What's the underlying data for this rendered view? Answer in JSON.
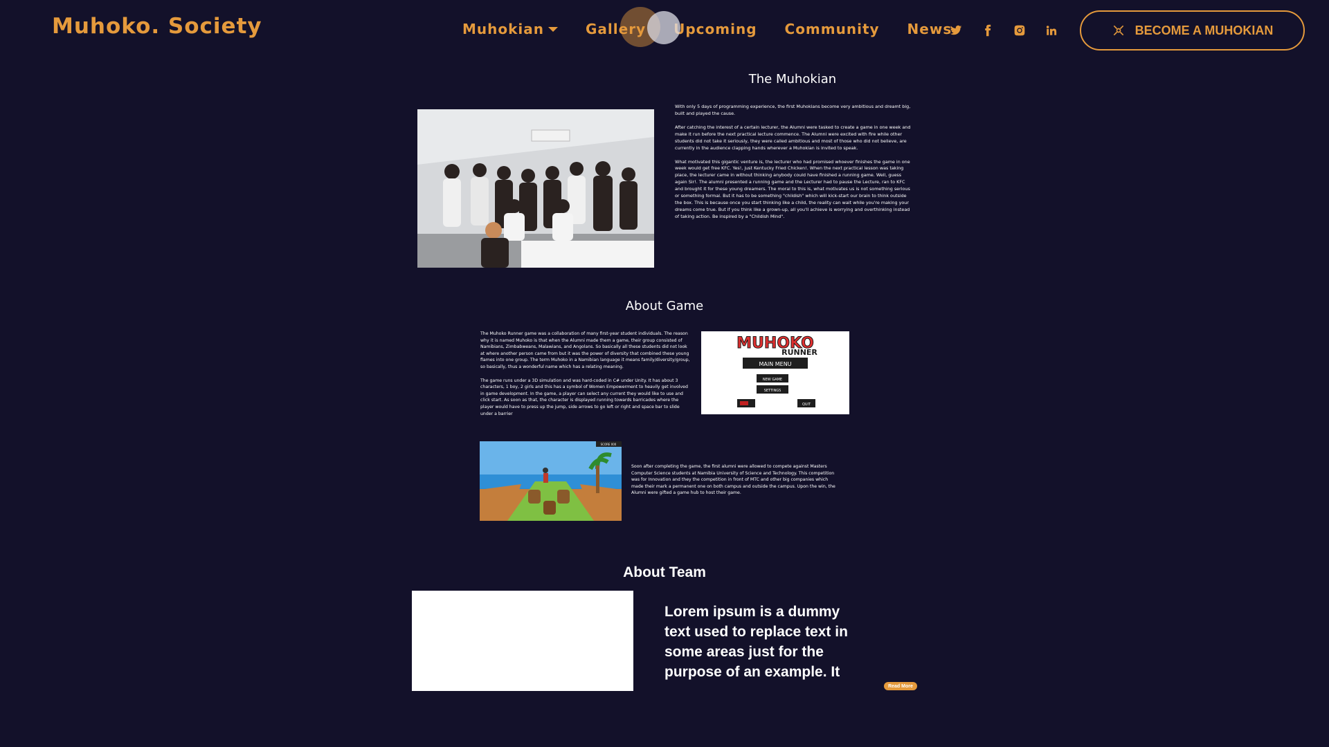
{
  "navbar": {
    "brand": "Muhoko. Society",
    "links": [
      {
        "label": "Muhokian",
        "dropdown": true
      },
      {
        "label": "Gallery"
      },
      {
        "label": "Upcoming"
      },
      {
        "label": "Community"
      },
      {
        "label": "News"
      }
    ],
    "socials": [
      "twitter-icon",
      "facebook-icon",
      "instagram-icon",
      "linkedin-icon"
    ],
    "cta_label": "BECOME A MUHOKIAN"
  },
  "muhokian": {
    "title": "The Muhokian",
    "paragraphs": [
      "With only 5 days of programming experience, the first Muhokians become very ambitious and dreamt big, built and played the cause.",
      "After catching the interest of a certain lecturer, the Alumni were tasked to create a game in one week and make it run before the next practical lecture commence. The Alumni were excited with fire while other students did not take it seriously, they were called ambitious and most of those who did not believe, are currently in the audience clapping hands wherever a Muhokian is invited to speak.",
      "What motivated this gigantic venture is, the lecturer who had promised whoever finishes the game in one week would get free KFC. Yes!, just Kentucky Fried Chicken!. When the next practical lesson was taking place, the lecturer came in without thinking anybody could have finished a running game. Well, guess again Sir!. The alumni presented a running game and the Lecturer had to pause the Lecture, ran to KFC and brought it for these young dreamers. The moral to this is, what motivates us is not something serious or something formal. But it has to be something \"childish\" which will kick-start our brain to think outside the box. This is because once you start thinking like a child, the reality can wait while you're making your dreams come true. But if you think like a grown-up, all you'll achieve is worrying and overthinking instead of taking action. Be inspired by a \"Childish Mind\"."
    ]
  },
  "game": {
    "title": "About Game",
    "paragraphs": [
      "The Muhoko Runner game was a collaboration of many first-year student individuals. The reason why it is named Muhoko is that when the Alumni made them a game, their group consisted of Namibians, Zimbabweans, Malawians, and Angolans. So basically all these students did not look at where another person came from but it was the power of diversity that combined these young flames into one group. The term Muhoko in a Namibian language it means family/diversity/group, so basically, thus a wonderful name which has a relating meaning.",
      "The game runs under a 3D simulation and was hard-coded in C# under Unity. It has about 3 characters, 1 boy, 2 girls and this has a symbol of Women Empowerment to heavily get involved in game development. In the game, a player can select any current they would like to use and click start. As soon as that, the character is displayed running towards barricades where the player would have to press up the jump, side arrows to go left or right and space bar to slide under a barrier"
    ],
    "competition": "Soon after completing the game, the first alumni were allowed to compete against Masters Computer Science students at Namibia University of Science and Technology. This competition was for Innovation and they the competition in front of MTC and other big companies which made their mark a permanent one on both campus and outside the campus. Upon the win, the Alumni were gifted a game hub to host their game.",
    "menu": {
      "logo_top": "MUHOKO",
      "logo_bottom": "RUNNER",
      "main_menu": "MAIN MENU",
      "new_game": "NEW GAME",
      "settings": "SETTINGS",
      "quit": "QUIT",
      "high_score": "SCORE 000"
    }
  },
  "team": {
    "title": "About Team",
    "text": "Lorem ipsum is a dummy text used to replace text in some areas just for the purpose of an example. It",
    "read_more": "Read More"
  },
  "colors": {
    "background": "#13112a",
    "accent": "#e59a3c"
  }
}
